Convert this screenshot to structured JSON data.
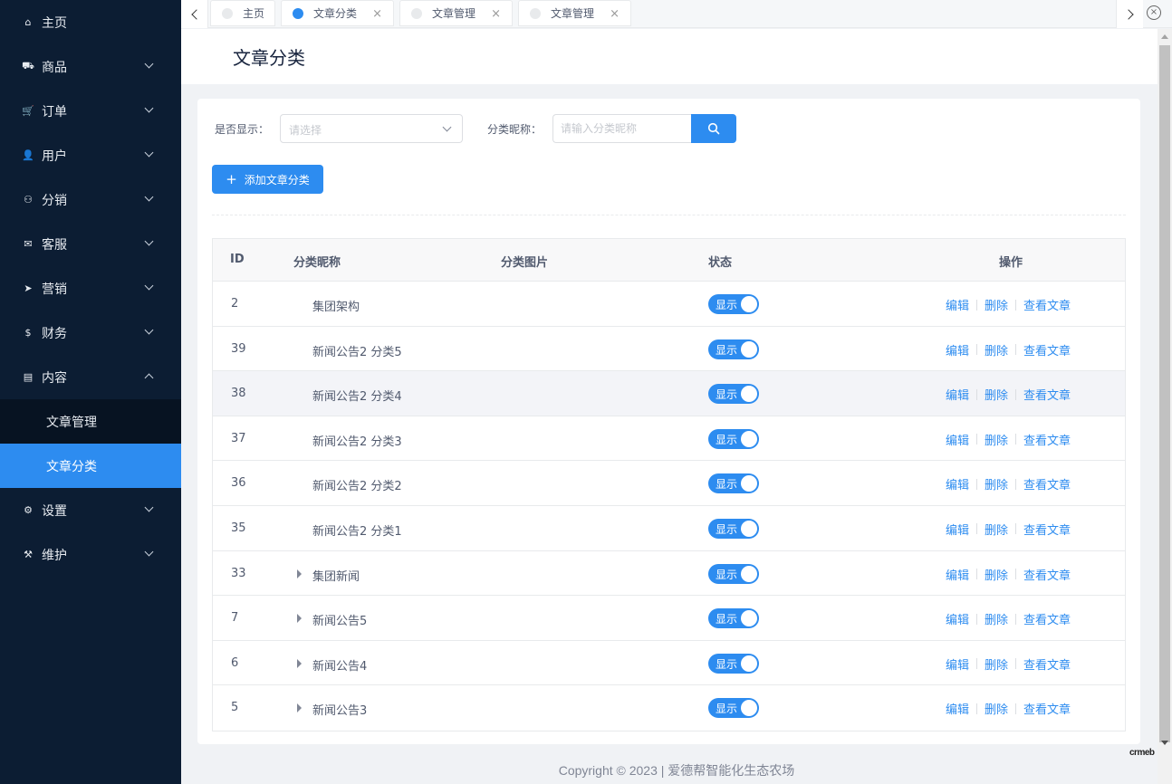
{
  "sidebar": {
    "items": [
      {
        "label": "主页",
        "icon": "home-icon",
        "glyph": "⌂"
      },
      {
        "label": "商品",
        "icon": "basket-icon",
        "glyph": "⛟"
      },
      {
        "label": "订单",
        "icon": "cart-icon",
        "glyph": "🛒"
      },
      {
        "label": "用户",
        "icon": "user-icon",
        "glyph": "👤"
      },
      {
        "label": "分销",
        "icon": "group-icon",
        "glyph": "⚇"
      },
      {
        "label": "客服",
        "icon": "chat-icon",
        "glyph": "✉"
      },
      {
        "label": "营销",
        "icon": "send-icon",
        "glyph": "➤"
      },
      {
        "label": "财务",
        "icon": "dollar-icon",
        "glyph": "$"
      },
      {
        "label": "内容",
        "icon": "book-icon",
        "glyph": "▤"
      },
      {
        "label": "设置",
        "icon": "gear-icon",
        "glyph": "⚙"
      },
      {
        "label": "维护",
        "icon": "hammer-icon",
        "glyph": "⚒"
      }
    ],
    "content_sub": [
      {
        "label": "文章管理"
      },
      {
        "label": "文章分类"
      }
    ]
  },
  "tabs": [
    {
      "label": "主页"
    },
    {
      "label": "文章分类"
    },
    {
      "label": "文章管理"
    },
    {
      "label": "文章管理"
    }
  ],
  "page": {
    "title": "文章分类"
  },
  "filters": {
    "show_label": "是否显示：",
    "show_placeholder": "请选择",
    "name_label": "分类昵称：",
    "name_placeholder": "请输入分类昵称"
  },
  "add_button": {
    "label": "添加文章分类"
  },
  "table": {
    "headers": {
      "id": "ID",
      "name": "分类昵称",
      "image": "分类图片",
      "status": "状态",
      "actions": "操作"
    },
    "rows": [
      {
        "id": "2",
        "name": "集团架构",
        "status": "显示"
      },
      {
        "id": "39",
        "name": "新闻公告2 分类5",
        "status": "显示"
      },
      {
        "id": "38",
        "name": "新闻公告2 分类4",
        "status": "显示"
      },
      {
        "id": "37",
        "name": "新闻公告2 分类3",
        "status": "显示"
      },
      {
        "id": "36",
        "name": "新闻公告2 分类2",
        "status": "显示"
      },
      {
        "id": "35",
        "name": "新闻公告2 分类1",
        "status": "显示"
      },
      {
        "id": "33",
        "name": "集团新闻",
        "status": "显示"
      },
      {
        "id": "7",
        "name": "新闻公告5",
        "status": "显示"
      },
      {
        "id": "6",
        "name": "新闻公告4",
        "status": "显示"
      },
      {
        "id": "5",
        "name": "新闻公告3",
        "status": "显示"
      }
    ],
    "actions": {
      "edit": "编辑",
      "delete": "删除",
      "view": "查看文章"
    }
  },
  "footer": {
    "copyright": "Copyright © 2023 | 爱德帮智能化生态农场"
  },
  "brand_mark": "crmeb",
  "colors": {
    "primary": "#2d8cf0",
    "sidebar_bg": "#0c1d33"
  }
}
